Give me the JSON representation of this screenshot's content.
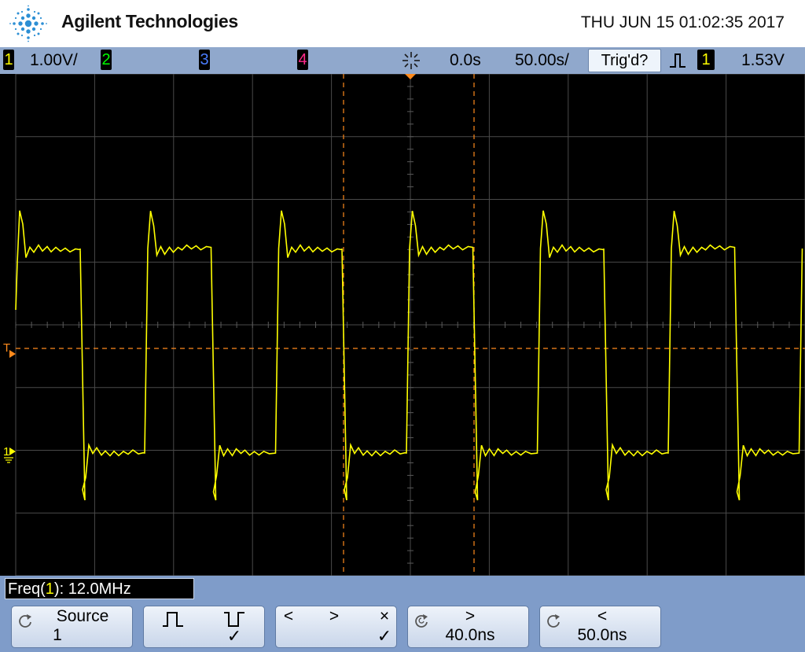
{
  "header": {
    "brand": "Agilent Technologies",
    "datetime": "THU JUN 15 01:02:35 2017"
  },
  "status": {
    "ch1_num": "1",
    "ch1_scale": "1.00V/",
    "ch2_num": "2",
    "ch3_num": "3",
    "ch4_num": "4",
    "time_delay": "0.0s",
    "time_scale": "50.00s/",
    "trigger_state": "Trig'd?",
    "trigger_source": "1",
    "trigger_level": "1.53V"
  },
  "markers": {
    "trigger_marker": "T",
    "ch1_ground_marker": "1"
  },
  "measurement": {
    "label": "Freq(",
    "channel": "1",
    "suffix": "): ",
    "value": "12.0MHz"
  },
  "softkeys": {
    "source_label": "Source",
    "source_value": "1",
    "nav_left": "<",
    "nav_right": ">",
    "nav_clear": "×",
    "delay_arrow": ">",
    "delay_value": "40.0ns",
    "hold_arrow": "<",
    "hold_value": "50.0ns",
    "check": "✓"
  },
  "colors": {
    "channel1": "#ffff00",
    "channel2": "#00ff00",
    "channel3": "#4a7dff",
    "channel4": "#ff2a8a",
    "cursor": "#ff8a1c",
    "grid": "#4a4a4a",
    "status_bar": "#90a8cc",
    "softkey_bar": "#7f9cc9"
  },
  "icons": {
    "logo": "agilent-spark-logo",
    "run_state": "starburst-icon",
    "trigger_slope": "rising-edge-icon",
    "softkey_refresh": "circular-arrow-icon"
  }
}
